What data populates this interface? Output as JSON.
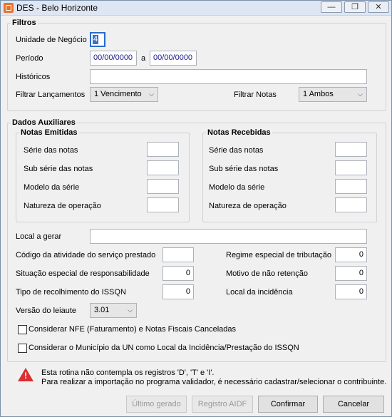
{
  "window": {
    "title": "DES - Belo Horizonte",
    "min": "—",
    "max": "❐",
    "close": "✕"
  },
  "filtros": {
    "legend": "Filtros",
    "unidade_label": "Unidade de Negócio",
    "unidade_value": "4",
    "periodo_label": "Período",
    "periodo_de": "00/00/0000",
    "periodo_sep": "a",
    "periodo_ate": "00/00/0000",
    "historicos_label": "Históricos",
    "historicos_value": "",
    "lancamentos_label": "Filtrar Lançamentos",
    "lancamentos_value": "1 Vencimento",
    "notas_label": "Filtrar Notas",
    "notas_value": "1 Ambos"
  },
  "aux": {
    "legend": "Dados Auxiliares",
    "emitidas": {
      "legend": "Notas Emitidas",
      "serie": "Série das notas",
      "subserie": "Sub série das notas",
      "modelo": "Modelo da série",
      "natureza": "Natureza de operação"
    },
    "recebidas": {
      "legend": "Notas Recebidas",
      "serie": "Série das notas",
      "subserie": "Sub série das notas",
      "modelo": "Modelo da série",
      "natureza": "Natureza de operação"
    },
    "local_gerar_label": "Local a gerar",
    "codigo_label": "Código da atividade do serviço prestado",
    "regime_label": "Regime especial de tributação",
    "regime_value": "0",
    "situacao_label": "Situação especial de responsabilidade",
    "situacao_value": "0",
    "motivo_label": "Motivo de não retenção",
    "motivo_value": "0",
    "tipo_label": "Tipo de recolhimento do ISSQN",
    "tipo_value": "0",
    "local_incid_label": "Local da incidência",
    "local_incid_value": "0",
    "versao_label": "Versão do leiaute",
    "versao_value": "3.01",
    "chk1": "Considerar NFE (Faturamento) e Notas Fiscais Canceladas",
    "chk2": "Considerar o Município da UN como Local da Incidência/Prestação do ISSQN"
  },
  "warning": {
    "line1": "Esta rotina não contempla os registros 'D', 'T' e 'I'.",
    "line2": "Para realizar a importação no programa validador, é necessário cadastrar/selecionar o contribuinte."
  },
  "buttons": {
    "ultimo": "Último gerado",
    "registro": "Registro AIDF",
    "confirmar": "Confirmar",
    "cancelar": "Cancelar"
  }
}
